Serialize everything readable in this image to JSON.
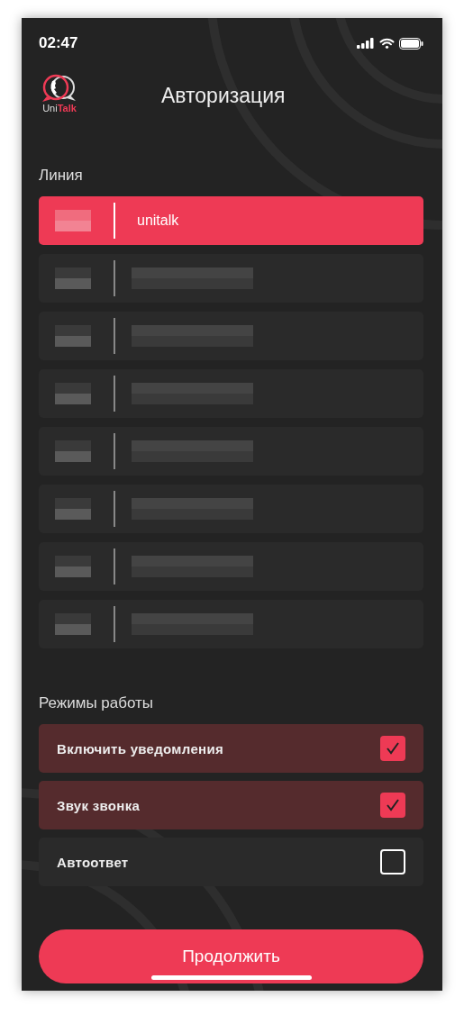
{
  "status_bar": {
    "time": "02:47"
  },
  "header": {
    "logo": {
      "part_1": "Uni",
      "part_2": "Talk"
    },
    "title": "Авторизация"
  },
  "lines": {
    "heading": "Линия",
    "rows": [
      {
        "label": "unitalk",
        "selected": true,
        "obscured": false
      },
      {
        "selected": false,
        "obscured": true
      },
      {
        "selected": false,
        "obscured": true
      },
      {
        "selected": false,
        "obscured": true
      },
      {
        "selected": false,
        "obscured": true
      },
      {
        "selected": false,
        "obscured": true
      },
      {
        "selected": false,
        "obscured": true
      },
      {
        "selected": false,
        "obscured": true
      }
    ]
  },
  "modes": {
    "heading": "Режимы работы",
    "options": [
      {
        "label": "Включить уведомления",
        "checked": true
      },
      {
        "label": "Звук звонка",
        "checked": true
      },
      {
        "label": "Автоответ",
        "checked": false
      }
    ]
  },
  "continue_button": "Продолжить"
}
